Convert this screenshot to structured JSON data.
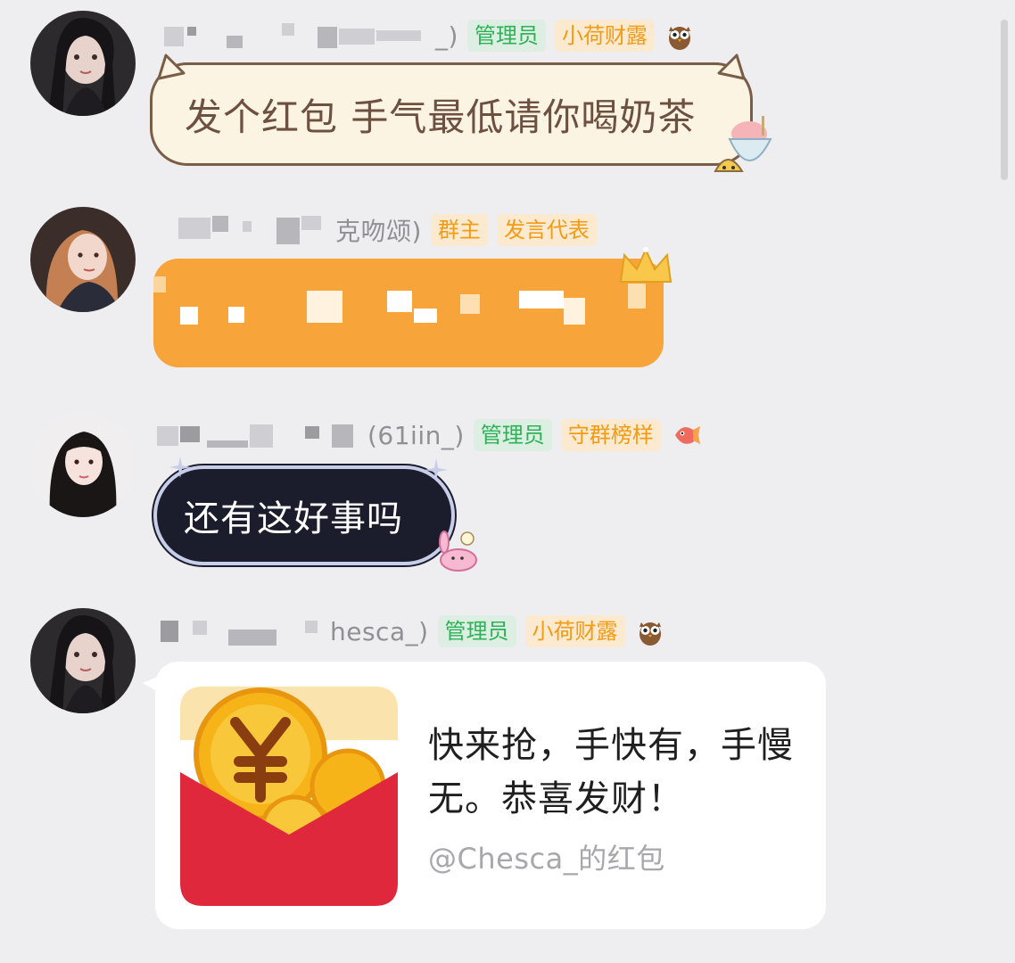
{
  "colors": {
    "background": "#eeeef1",
    "badge_green": "#2fb257",
    "badge_orange": "#f29b13",
    "orange_bubble": "#f7a53b",
    "dark_bubble": "#1c1d2c",
    "red_packet": "#e0283d"
  },
  "messages": [
    {
      "nick_visible": "_)",
      "badges": [
        "管理员",
        "小荷财露"
      ],
      "deco_icon": "owl-icon",
      "text": "发个红包 手气最低请你喝奶茶"
    },
    {
      "nick_visible": "克吻颂)",
      "badges": [
        "群主",
        "发言代表"
      ],
      "text": ""
    },
    {
      "nick_visible": "(61iin_)",
      "badges": [
        "管理员",
        "守群榜样"
      ],
      "deco_icon": "fish-icon",
      "text": "还有这好事吗"
    },
    {
      "nick_visible": "hesca_)",
      "badges": [
        "管理员",
        "小荷财露"
      ],
      "deco_icon": "owl-icon",
      "red_packet": {
        "message": "快来抢，手快有，手慢无。恭喜发财！",
        "from": "@Chesca_的红包"
      }
    }
  ]
}
